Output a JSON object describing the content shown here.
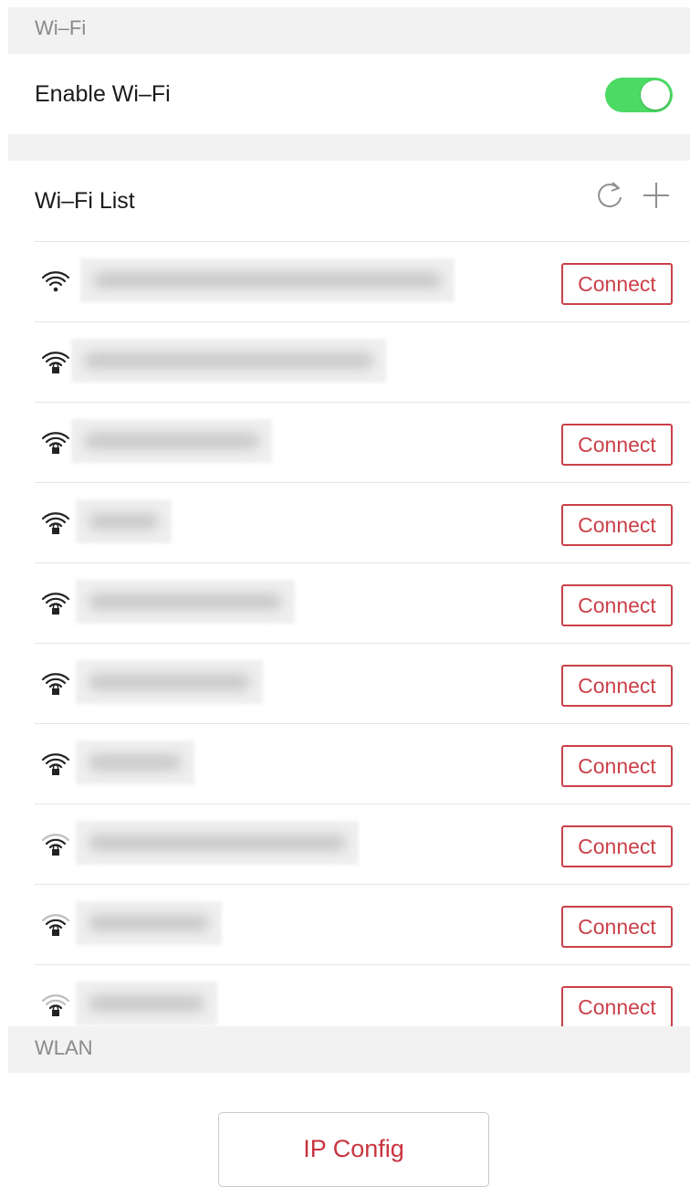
{
  "wifi_section": {
    "label": "Wi–Fi"
  },
  "enable_row": {
    "label": "Enable Wi–Fi",
    "enabled": true,
    "toggle_color": "#4cd964"
  },
  "list_header": {
    "title": "Wi–Fi List",
    "icons": [
      "refresh-icon",
      "add-icon"
    ]
  },
  "networks": [
    {
      "secured": false,
      "signal": "strong",
      "connect_label": "Connect"
    },
    {
      "secured": true,
      "signal": "strong",
      "connect_label": ""
    },
    {
      "secured": true,
      "signal": "strong",
      "connect_label": "Connect"
    },
    {
      "secured": true,
      "signal": "strong",
      "connect_label": "Connect"
    },
    {
      "secured": true,
      "signal": "strong",
      "connect_label": "Connect"
    },
    {
      "secured": true,
      "signal": "strong",
      "connect_label": "Connect"
    },
    {
      "secured": true,
      "signal": "strong",
      "connect_label": "Connect"
    },
    {
      "secured": true,
      "signal": "medium",
      "connect_label": "Connect"
    },
    {
      "secured": true,
      "signal": "medium",
      "connect_label": "Connect"
    },
    {
      "secured": true,
      "signal": "weak",
      "connect_label": "Connect"
    }
  ],
  "wlan_section": {
    "label": "WLAN"
  },
  "ip_config": {
    "label": "IP Config"
  },
  "colors": {
    "accent": "#cb4049",
    "toggle_on": "#4cd964",
    "section_bg": "#f2f2f3"
  }
}
